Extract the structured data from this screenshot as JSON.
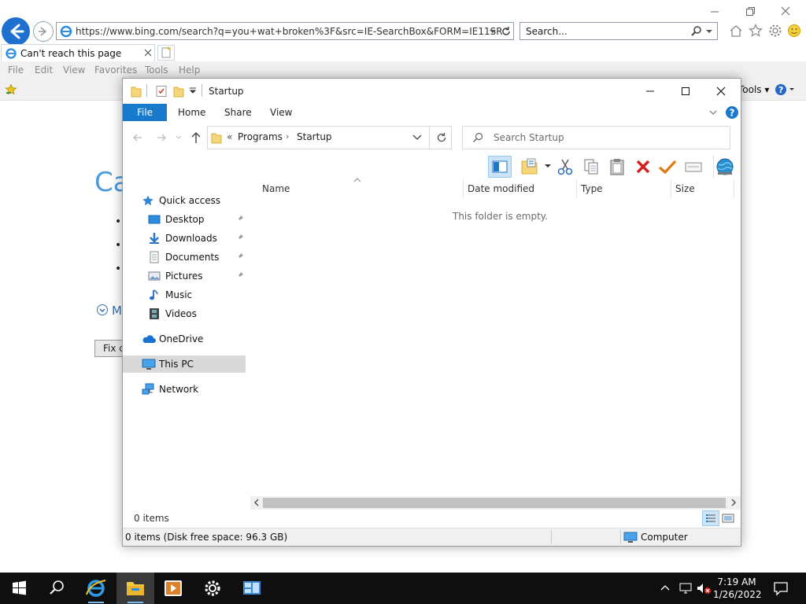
{
  "browser": {
    "url": "https://www.bing.com/search?q=you+wat+broken%3F&src=IE-SearchBox&FORM=IE11SR",
    "search_placeholder": "Search...",
    "tab_title": "Can't reach this page",
    "menu": [
      "File",
      "Edit",
      "View",
      "Favorites",
      "Tools",
      "Help"
    ],
    "tools_label": "Tools",
    "page": {
      "heading_fragment": "Ca",
      "more_fragment": "M",
      "button_fragment": "Fix c"
    }
  },
  "explorer": {
    "title": "Startup",
    "ribbon_tabs": [
      "File",
      "Home",
      "Share",
      "View"
    ],
    "breadcrumb": {
      "overflow": "«",
      "items": [
        "Programs",
        "Startup"
      ]
    },
    "search_placeholder": "Search Startup",
    "columns": [
      "Name",
      "Date modified",
      "Type",
      "Size"
    ],
    "empty_message": "This folder is empty.",
    "nav": {
      "quick_access": "Quick access",
      "pinned": [
        "Desktop",
        "Downloads",
        "Documents",
        "Pictures"
      ],
      "unpinned": [
        "Music",
        "Videos"
      ],
      "onedrive": "OneDrive",
      "this_pc": "This PC",
      "network": "Network"
    },
    "status_items": "0 items",
    "disk_status": "0 items (Disk free space: 96.3 GB)",
    "computer_label": "Computer"
  },
  "taskbar": {
    "time": "7:19 AM",
    "date": "1/26/2022"
  }
}
